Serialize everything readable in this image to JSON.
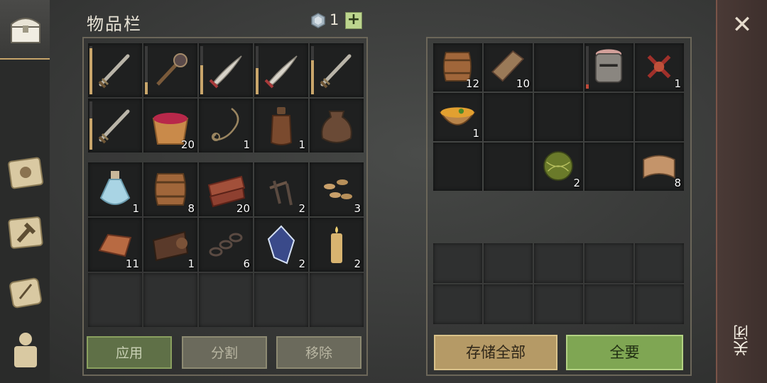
{
  "header": {
    "title": "物品栏",
    "gem_count": "1",
    "plus_label": "+"
  },
  "inventory": {
    "weapons": [
      {
        "icon": "sword-icon",
        "count": "",
        "durability": 0.95
      },
      {
        "icon": "spiked-mace-icon",
        "count": "",
        "durability": 0.25
      },
      {
        "icon": "scimitar-icon",
        "count": "",
        "durability": 0.6
      },
      {
        "icon": "scimitar-icon",
        "count": "",
        "durability": 0.55
      },
      {
        "icon": "sword-icon",
        "count": "",
        "durability": 0.7
      },
      {
        "icon": "sword-icon",
        "count": "",
        "durability": 0.65
      },
      {
        "icon": "berry-bucket-icon",
        "count": "20"
      },
      {
        "icon": "rope-icon",
        "count": "1"
      },
      {
        "icon": "flask-icon",
        "count": "1"
      },
      {
        "icon": "sack-icon",
        "count": ""
      }
    ],
    "items": [
      {
        "icon": "potion-icon",
        "count": "1"
      },
      {
        "icon": "barrel-icon",
        "count": "8"
      },
      {
        "icon": "leather-strips-icon",
        "count": "20"
      },
      {
        "icon": "nails-icon",
        "count": "2"
      },
      {
        "icon": "seeds-icon",
        "count": "3"
      },
      {
        "icon": "copper-ingot-icon",
        "count": "11"
      },
      {
        "icon": "leather-roll-icon",
        "count": "1"
      },
      {
        "icon": "chain-icon",
        "count": "6"
      },
      {
        "icon": "crystal-icon",
        "count": "2"
      },
      {
        "icon": "candle-icon",
        "count": "2"
      }
    ],
    "buttons": {
      "apply": "应用",
      "split": "分割",
      "remove": "移除"
    }
  },
  "storage": {
    "items": [
      {
        "icon": "barrel-icon",
        "count": "12"
      },
      {
        "icon": "wood-plank-icon",
        "count": "10"
      },
      {
        "icon": "empty",
        "count": ""
      },
      {
        "icon": "knight-helmet-icon",
        "count": "",
        "durability": 0.1
      },
      {
        "icon": "red-knot-icon",
        "count": "1"
      },
      {
        "icon": "soup-bowl-icon",
        "count": "1"
      },
      {
        "icon": "empty",
        "count": ""
      },
      {
        "icon": "empty",
        "count": ""
      },
      {
        "icon": "empty",
        "count": ""
      },
      {
        "icon": "empty",
        "count": ""
      },
      {
        "icon": "empty",
        "count": ""
      },
      {
        "icon": "empty",
        "count": ""
      },
      {
        "icon": "fiber-ball-icon",
        "count": "2"
      },
      {
        "icon": "empty",
        "count": ""
      },
      {
        "icon": "cloth-icon",
        "count": "8"
      }
    ],
    "buttons": {
      "store_all": "存储全部",
      "take_all": "全要"
    }
  },
  "close": {
    "label": "关闭"
  },
  "colors": {
    "accent_gold": "#c9a66b",
    "button_green": "#7fa653",
    "button_gold": "#b59a66"
  }
}
